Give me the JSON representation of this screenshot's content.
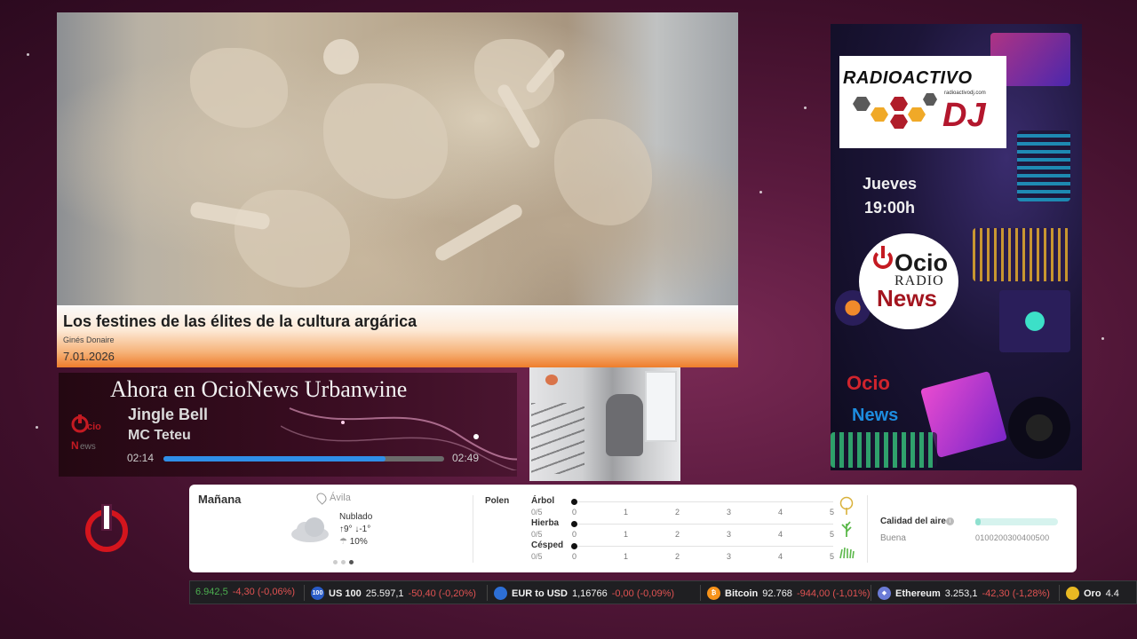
{
  "news": {
    "title": "Los festines de las élites de la cultura argárica",
    "author": "Ginés Donaire",
    "date": "7.01.2026"
  },
  "now_playing": {
    "heading": "Ahora en OcioNews Urbanwine",
    "song": "Jingle Bell",
    "artist": "MC Teteu",
    "elapsed": "02:14",
    "duration": "02:49",
    "progress": 0.79
  },
  "poster": {
    "radio_brand": "RADIOACTIVO",
    "radio_url": "radioactivodj.com",
    "dj_word": "DJ",
    "day": "Jueves",
    "time": "19:00h",
    "ocio_logo": {
      "ocio": "Ocio",
      "radio": "RADIO",
      "news": "News"
    },
    "ocio2": "Ocio",
    "news2": "News"
  },
  "weather": {
    "day_label": "Mañana",
    "location": "Ávila",
    "condition": "Nublado",
    "temps": "↑9° ↓-1°",
    "precip": "10%",
    "pollen": {
      "label": "Polen",
      "items": [
        {
          "name": "Árbol",
          "score": "0/5",
          "icon": "tree-icon"
        },
        {
          "name": "Hierba",
          "score": "0/5",
          "icon": "grass-icon"
        },
        {
          "name": "Césped",
          "score": "0/5",
          "icon": "lawn-icon"
        }
      ],
      "scale": [
        "0",
        "1",
        "2",
        "3",
        "4",
        "5"
      ]
    },
    "air_quality": {
      "label": "Calidad del aire",
      "status": "Buena",
      "scale": "0100200300400500",
      "level": 0.06
    }
  },
  "ticker": [
    {
      "name": "",
      "value": "6.942,5",
      "change": "-4,30 (-0,06%)"
    },
    {
      "name": "US 100",
      "value": "25.597,1",
      "change": "-50,40 (-0,20%)",
      "icon_text": "100",
      "icon_color": "#2a5cc7"
    },
    {
      "name": "EUR to USD",
      "value": "1,16766",
      "change": "-0,00 (-0,09%)",
      "icon_color": "#2d6fd6"
    },
    {
      "name": "Bitcoin",
      "value": "92.768",
      "change": "-944,00 (-1,01%)",
      "icon_text": "₿",
      "icon_color": "#f7931a"
    },
    {
      "name": "Ethereum",
      "value": "3.253,1",
      "change": "-42,30 (-1,28%)",
      "icon_text": "◆",
      "icon_color": "#6b7bd6"
    },
    {
      "name": "Oro",
      "value": "4.4",
      "change": "",
      "icon_color": "#e8b923"
    }
  ]
}
